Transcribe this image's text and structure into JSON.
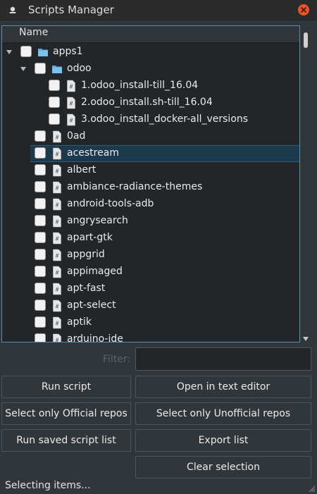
{
  "window": {
    "title": "Scripts Manager"
  },
  "tree": {
    "header": "Name",
    "rows": [
      {
        "label": "apps1",
        "type": "folder",
        "depth": 0,
        "expanded": true
      },
      {
        "label": "odoo",
        "type": "folder",
        "depth": 1,
        "expanded": true
      },
      {
        "label": "1.odoo_install-till_16.04",
        "type": "script",
        "depth": 2
      },
      {
        "label": "2.odoo_install.sh-till_16.04",
        "type": "script",
        "depth": 2
      },
      {
        "label": "3.odoo_install_docker-all_versions",
        "type": "script",
        "depth": 2
      },
      {
        "label": "0ad",
        "type": "script",
        "depth": 1
      },
      {
        "label": "acestream",
        "type": "script",
        "depth": 1,
        "selected": true
      },
      {
        "label": "albert",
        "type": "script",
        "depth": 1
      },
      {
        "label": "ambiance-radiance-themes",
        "type": "script",
        "depth": 1
      },
      {
        "label": "android-tools-adb",
        "type": "script",
        "depth": 1
      },
      {
        "label": "angrysearch",
        "type": "script",
        "depth": 1
      },
      {
        "label": "apart-gtk",
        "type": "script",
        "depth": 1
      },
      {
        "label": "appgrid",
        "type": "script",
        "depth": 1
      },
      {
        "label": "appimaged",
        "type": "script",
        "depth": 1
      },
      {
        "label": "apt-fast",
        "type": "script",
        "depth": 1
      },
      {
        "label": "apt-select",
        "type": "script",
        "depth": 1
      },
      {
        "label": "aptik",
        "type": "script",
        "depth": 1
      },
      {
        "label": "arduino-ide",
        "type": "script",
        "depth": 1
      }
    ]
  },
  "filter": {
    "label": "Filter:",
    "value": ""
  },
  "buttons": {
    "run_script": "Run script",
    "open_editor": "Open in text editor",
    "select_official": "Select only Official repos",
    "select_unofficial": "Select only Unofficial repos",
    "run_saved": "Run saved script list",
    "export_list": "Export list",
    "clear_selection": "Clear selection"
  },
  "status": {
    "text": "Selecting items..."
  },
  "icons": {
    "window": "app-icon",
    "close": "close-icon",
    "folder": "folder-icon",
    "script": "script-file-icon"
  },
  "colors": {
    "accent": "#5b8cb0",
    "selection": "#1d3a4d",
    "folder": "#5aa9de",
    "close": "#e9542a"
  }
}
